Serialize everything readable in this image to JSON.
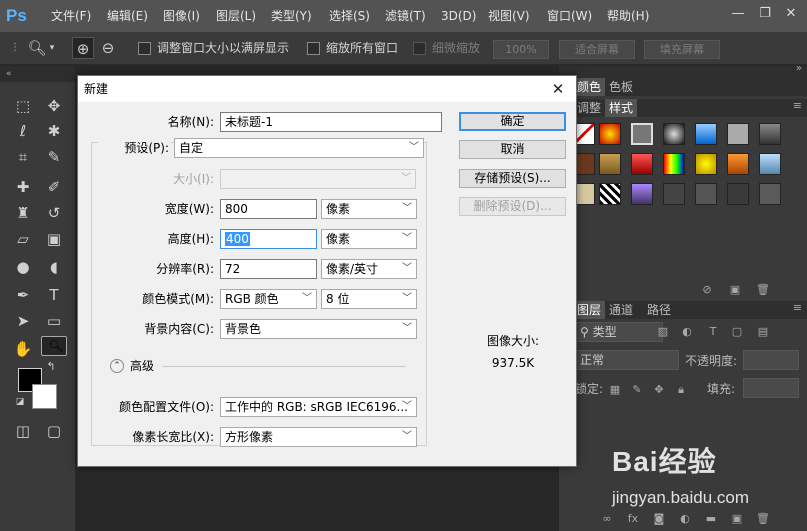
{
  "app": {
    "logo": "Ps"
  },
  "menu": [
    "文件(F)",
    "编辑(E)",
    "图像(I)",
    "图层(L)",
    "类型(Y)",
    "选择(S)",
    "滤镜(T)",
    "3D(D)",
    "视图(V)",
    "窗口(W)",
    "帮助(H)"
  ],
  "window_controls": {
    "minimize": "—",
    "restore": "❐",
    "close": "✕"
  },
  "options_bar": {
    "fit_window": "调整窗口大小以满屏显示",
    "zoom_all": "缩放所有窗口",
    "scrubby_zoom": "细微缩放",
    "zoom_percent": "100%",
    "fit_screen": "适合屏幕",
    "fill_screen": "填充屏幕"
  },
  "right_panel": {
    "tabs_top": [
      "颜色",
      "色板"
    ],
    "tabs_styles": [
      "调整",
      "样式"
    ],
    "tabs_layers": [
      "图层",
      "通道",
      "路径"
    ],
    "kind_label": "类型",
    "blend_mode": "正常",
    "opacity_label": "不透明度:",
    "lock_label": "锁定:",
    "fill_label": "填充:"
  },
  "dialog": {
    "title": "新建",
    "name_label": "名称(N):",
    "name_value": "未标题-1",
    "preset_label": "预设(P):",
    "preset_value": "自定",
    "size_label": "大小(I):",
    "width_label": "宽度(W):",
    "width_value": "800",
    "width_unit": "像素",
    "height_label": "高度(H):",
    "height_value": "400",
    "height_unit": "像素",
    "resolution_label": "分辨率(R):",
    "resolution_value": "72",
    "resolution_unit": "像素/英寸",
    "color_mode_label": "颜色模式(M):",
    "color_mode_value": "RGB 颜色",
    "bit_depth": "8 位",
    "background_label": "背景内容(C):",
    "background_value": "背景色",
    "advanced_label": "高级",
    "color_profile_label": "颜色配置文件(O):",
    "color_profile_value": "工作中的 RGB: sRGB IEC6196...",
    "pixel_aspect_label": "像素长宽比(X):",
    "pixel_aspect_value": "方形像素",
    "buttons": {
      "ok": "确定",
      "cancel": "取消",
      "save_preset": "存储预设(S)...",
      "delete_preset": "删除预设(D)..."
    },
    "image_size_label": "图像大小:",
    "image_size_value": "937.5K"
  },
  "watermark": {
    "brand": "Bai经验",
    "url": "jingyan.baidu.com"
  }
}
